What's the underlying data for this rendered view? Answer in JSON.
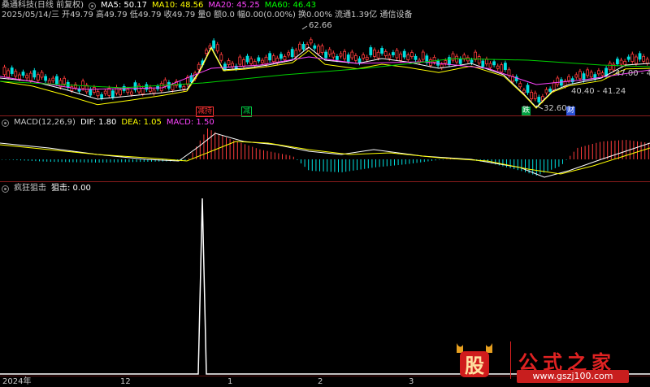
{
  "header": {
    "stock_name": "桑通科技(日线 前复权)",
    "ma5": "MA5: 50.17",
    "ma10": "MA10: 48.56",
    "ma20": "MA20: 45.25",
    "ma60": "MA60: 46.43",
    "info_line": "2025/05/14/三 开49.79 高49.79 低49.79 收49.79 量0 额0.0 幅0.00(0.00%) 换0.00% 流通1.39亿 通信设备",
    "colors": {
      "ma5": "#ffffff",
      "ma10": "#ffff00",
      "ma20": "#ff44ff",
      "ma60": "#00ff00",
      "info": "#c8c8c8"
    }
  },
  "main_chart": {
    "high_label": "62.66",
    "low_label": "32.60",
    "range_label_1": "40.40 - 41.24",
    "range_label_2": "47.00 - 4",
    "badges": [
      {
        "text": "减持",
        "color": "#ff3333"
      },
      {
        "text": "减",
        "color": "#00cc44"
      },
      {
        "text": "跌",
        "color": "#00cc44"
      },
      {
        "text": "财",
        "color": "#3366ff"
      }
    ]
  },
  "macd_panel": {
    "title": "MACD(12,26,9)",
    "dif": "DIF: 1.80",
    "dea": "DEA: 1.05",
    "macd": "MACD: 1.50",
    "colors": {
      "title": "#c8c8c8",
      "dif": "#ffffff",
      "dea": "#ffff00",
      "macd": "#ff44ff"
    }
  },
  "indicator_panel": {
    "title": "疯狂狙击",
    "value": "狙击: 0.00"
  },
  "x_axis": {
    "labels": [
      "2024年",
      "12",
      "1",
      "2",
      "3"
    ]
  },
  "watermark": {
    "logo_char": "股",
    "text": "公式之家",
    "url": "www.gszj100.com"
  }
}
